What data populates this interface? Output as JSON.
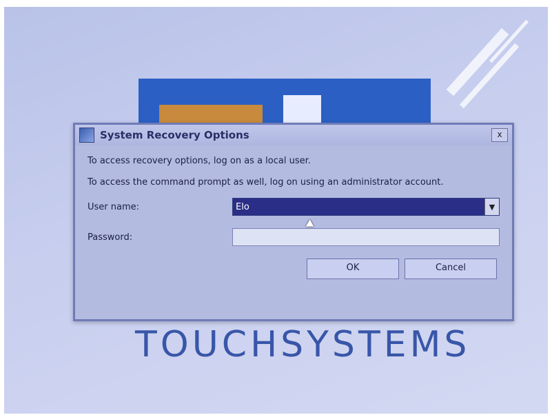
{
  "dialog": {
    "title": "System Recovery Options",
    "close_label": "x",
    "line1": "To access recovery options, log on as a local user.",
    "line2": "To access the command prompt as well, log on using an administrator account.",
    "username_label": "User name:",
    "username_value": "Elo",
    "password_label": "Password:",
    "password_value": "",
    "ok_label": "OK",
    "cancel_label": "Cancel"
  },
  "brand_text": "TOUCHSYSTEMS",
  "colors": {
    "screen_bg": "#c6cdee",
    "dialog_bg": "#b4bbe1",
    "select_bg": "#2a2e86",
    "brand_text": "#3856a8",
    "logo_blue": "#2b5fc4",
    "logo_orange": "#c88a3c"
  }
}
